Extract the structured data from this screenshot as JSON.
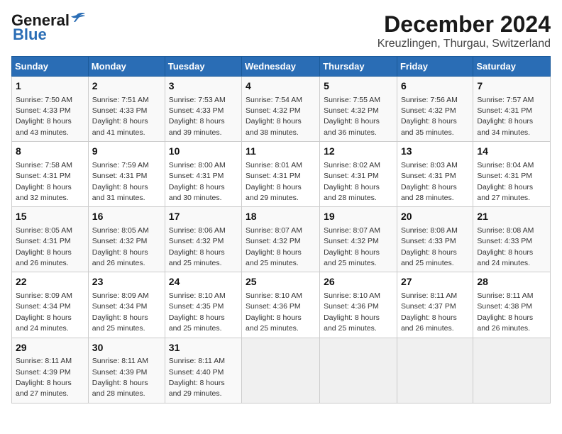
{
  "logo": {
    "general": "General",
    "blue": "Blue"
  },
  "title": "December 2024",
  "subtitle": "Kreuzlingen, Thurgau, Switzerland",
  "days_header": [
    "Sunday",
    "Monday",
    "Tuesday",
    "Wednesday",
    "Thursday",
    "Friday",
    "Saturday"
  ],
  "weeks": [
    [
      {
        "day": "1",
        "sunrise": "7:50 AM",
        "sunset": "4:33 PM",
        "daylight": "8 hours and 43 minutes."
      },
      {
        "day": "2",
        "sunrise": "7:51 AM",
        "sunset": "4:33 PM",
        "daylight": "8 hours and 41 minutes."
      },
      {
        "day": "3",
        "sunrise": "7:53 AM",
        "sunset": "4:33 PM",
        "daylight": "8 hours and 39 minutes."
      },
      {
        "day": "4",
        "sunrise": "7:54 AM",
        "sunset": "4:32 PM",
        "daylight": "8 hours and 38 minutes."
      },
      {
        "day": "5",
        "sunrise": "7:55 AM",
        "sunset": "4:32 PM",
        "daylight": "8 hours and 36 minutes."
      },
      {
        "day": "6",
        "sunrise": "7:56 AM",
        "sunset": "4:32 PM",
        "daylight": "8 hours and 35 minutes."
      },
      {
        "day": "7",
        "sunrise": "7:57 AM",
        "sunset": "4:31 PM",
        "daylight": "8 hours and 34 minutes."
      }
    ],
    [
      {
        "day": "8",
        "sunrise": "7:58 AM",
        "sunset": "4:31 PM",
        "daylight": "8 hours and 32 minutes."
      },
      {
        "day": "9",
        "sunrise": "7:59 AM",
        "sunset": "4:31 PM",
        "daylight": "8 hours and 31 minutes."
      },
      {
        "day": "10",
        "sunrise": "8:00 AM",
        "sunset": "4:31 PM",
        "daylight": "8 hours and 30 minutes."
      },
      {
        "day": "11",
        "sunrise": "8:01 AM",
        "sunset": "4:31 PM",
        "daylight": "8 hours and 29 minutes."
      },
      {
        "day": "12",
        "sunrise": "8:02 AM",
        "sunset": "4:31 PM",
        "daylight": "8 hours and 28 minutes."
      },
      {
        "day": "13",
        "sunrise": "8:03 AM",
        "sunset": "4:31 PM",
        "daylight": "8 hours and 28 minutes."
      },
      {
        "day": "14",
        "sunrise": "8:04 AM",
        "sunset": "4:31 PM",
        "daylight": "8 hours and 27 minutes."
      }
    ],
    [
      {
        "day": "15",
        "sunrise": "8:05 AM",
        "sunset": "4:31 PM",
        "daylight": "8 hours and 26 minutes."
      },
      {
        "day": "16",
        "sunrise": "8:05 AM",
        "sunset": "4:32 PM",
        "daylight": "8 hours and 26 minutes."
      },
      {
        "day": "17",
        "sunrise": "8:06 AM",
        "sunset": "4:32 PM",
        "daylight": "8 hours and 25 minutes."
      },
      {
        "day": "18",
        "sunrise": "8:07 AM",
        "sunset": "4:32 PM",
        "daylight": "8 hours and 25 minutes."
      },
      {
        "day": "19",
        "sunrise": "8:07 AM",
        "sunset": "4:32 PM",
        "daylight": "8 hours and 25 minutes."
      },
      {
        "day": "20",
        "sunrise": "8:08 AM",
        "sunset": "4:33 PM",
        "daylight": "8 hours and 25 minutes."
      },
      {
        "day": "21",
        "sunrise": "8:08 AM",
        "sunset": "4:33 PM",
        "daylight": "8 hours and 24 minutes."
      }
    ],
    [
      {
        "day": "22",
        "sunrise": "8:09 AM",
        "sunset": "4:34 PM",
        "daylight": "8 hours and 24 minutes."
      },
      {
        "day": "23",
        "sunrise": "8:09 AM",
        "sunset": "4:34 PM",
        "daylight": "8 hours and 25 minutes."
      },
      {
        "day": "24",
        "sunrise": "8:10 AM",
        "sunset": "4:35 PM",
        "daylight": "8 hours and 25 minutes."
      },
      {
        "day": "25",
        "sunrise": "8:10 AM",
        "sunset": "4:36 PM",
        "daylight": "8 hours and 25 minutes."
      },
      {
        "day": "26",
        "sunrise": "8:10 AM",
        "sunset": "4:36 PM",
        "daylight": "8 hours and 25 minutes."
      },
      {
        "day": "27",
        "sunrise": "8:11 AM",
        "sunset": "4:37 PM",
        "daylight": "8 hours and 26 minutes."
      },
      {
        "day": "28",
        "sunrise": "8:11 AM",
        "sunset": "4:38 PM",
        "daylight": "8 hours and 26 minutes."
      }
    ],
    [
      {
        "day": "29",
        "sunrise": "8:11 AM",
        "sunset": "4:39 PM",
        "daylight": "8 hours and 27 minutes."
      },
      {
        "day": "30",
        "sunrise": "8:11 AM",
        "sunset": "4:39 PM",
        "daylight": "8 hours and 28 minutes."
      },
      {
        "day": "31",
        "sunrise": "8:11 AM",
        "sunset": "4:40 PM",
        "daylight": "8 hours and 29 minutes."
      },
      null,
      null,
      null,
      null
    ]
  ],
  "labels": {
    "sunrise": "Sunrise:",
    "sunset": "Sunset:",
    "daylight": "Daylight:"
  }
}
